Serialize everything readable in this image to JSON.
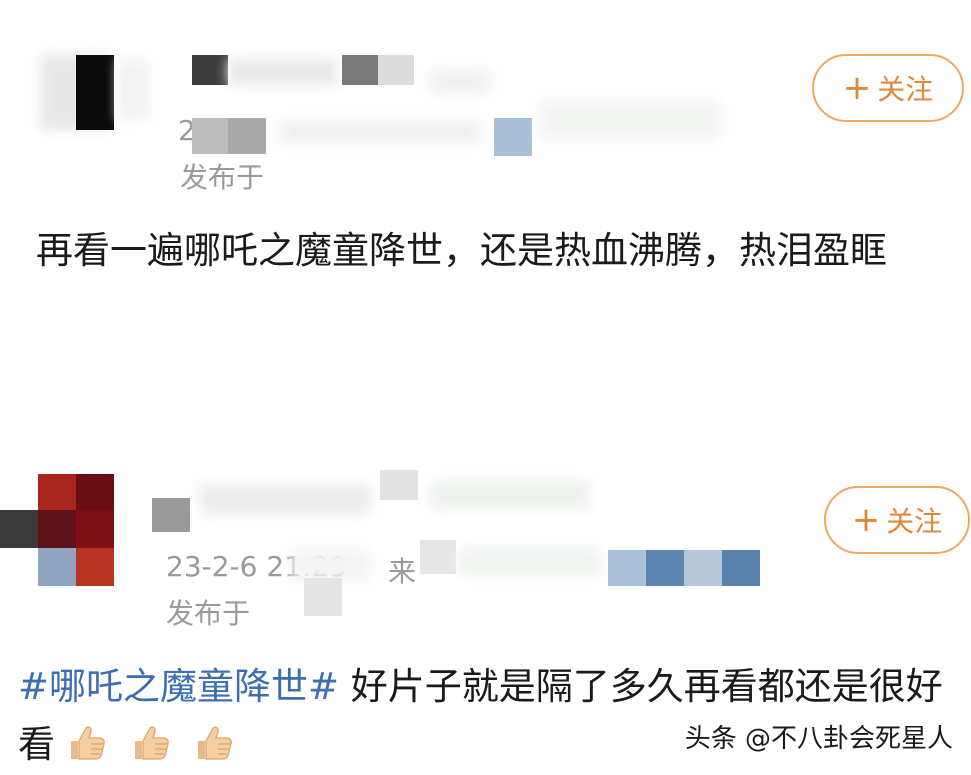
{
  "posts": [
    {
      "follow_label": "关注",
      "follow_icon": "plus-icon",
      "date_text": "2",
      "published_prefix": "发布于",
      "body": "再看一遍哪吒之魔童降世，还是热血沸腾，热泪盈眶"
    },
    {
      "follow_label": "关注",
      "follow_icon": "plus-icon",
      "date_text": "23-2-6 21:29",
      "source_prefix": "来",
      "published_prefix": "发布于",
      "hashtag": "#哪吒之魔童降世#",
      "body": "好片子就是隔了多久再看都还是很好看",
      "emoji": "thumbs-up-icon",
      "emoji_count": 3
    }
  ],
  "watermark": "头条 @不八卦会死星人",
  "colors": {
    "accent": "#e0883a",
    "follow_border": "#f0a860",
    "hashtag": "#3d6fb0",
    "meta_text": "#9a9a9a",
    "body_text": "#1a1a1a"
  }
}
